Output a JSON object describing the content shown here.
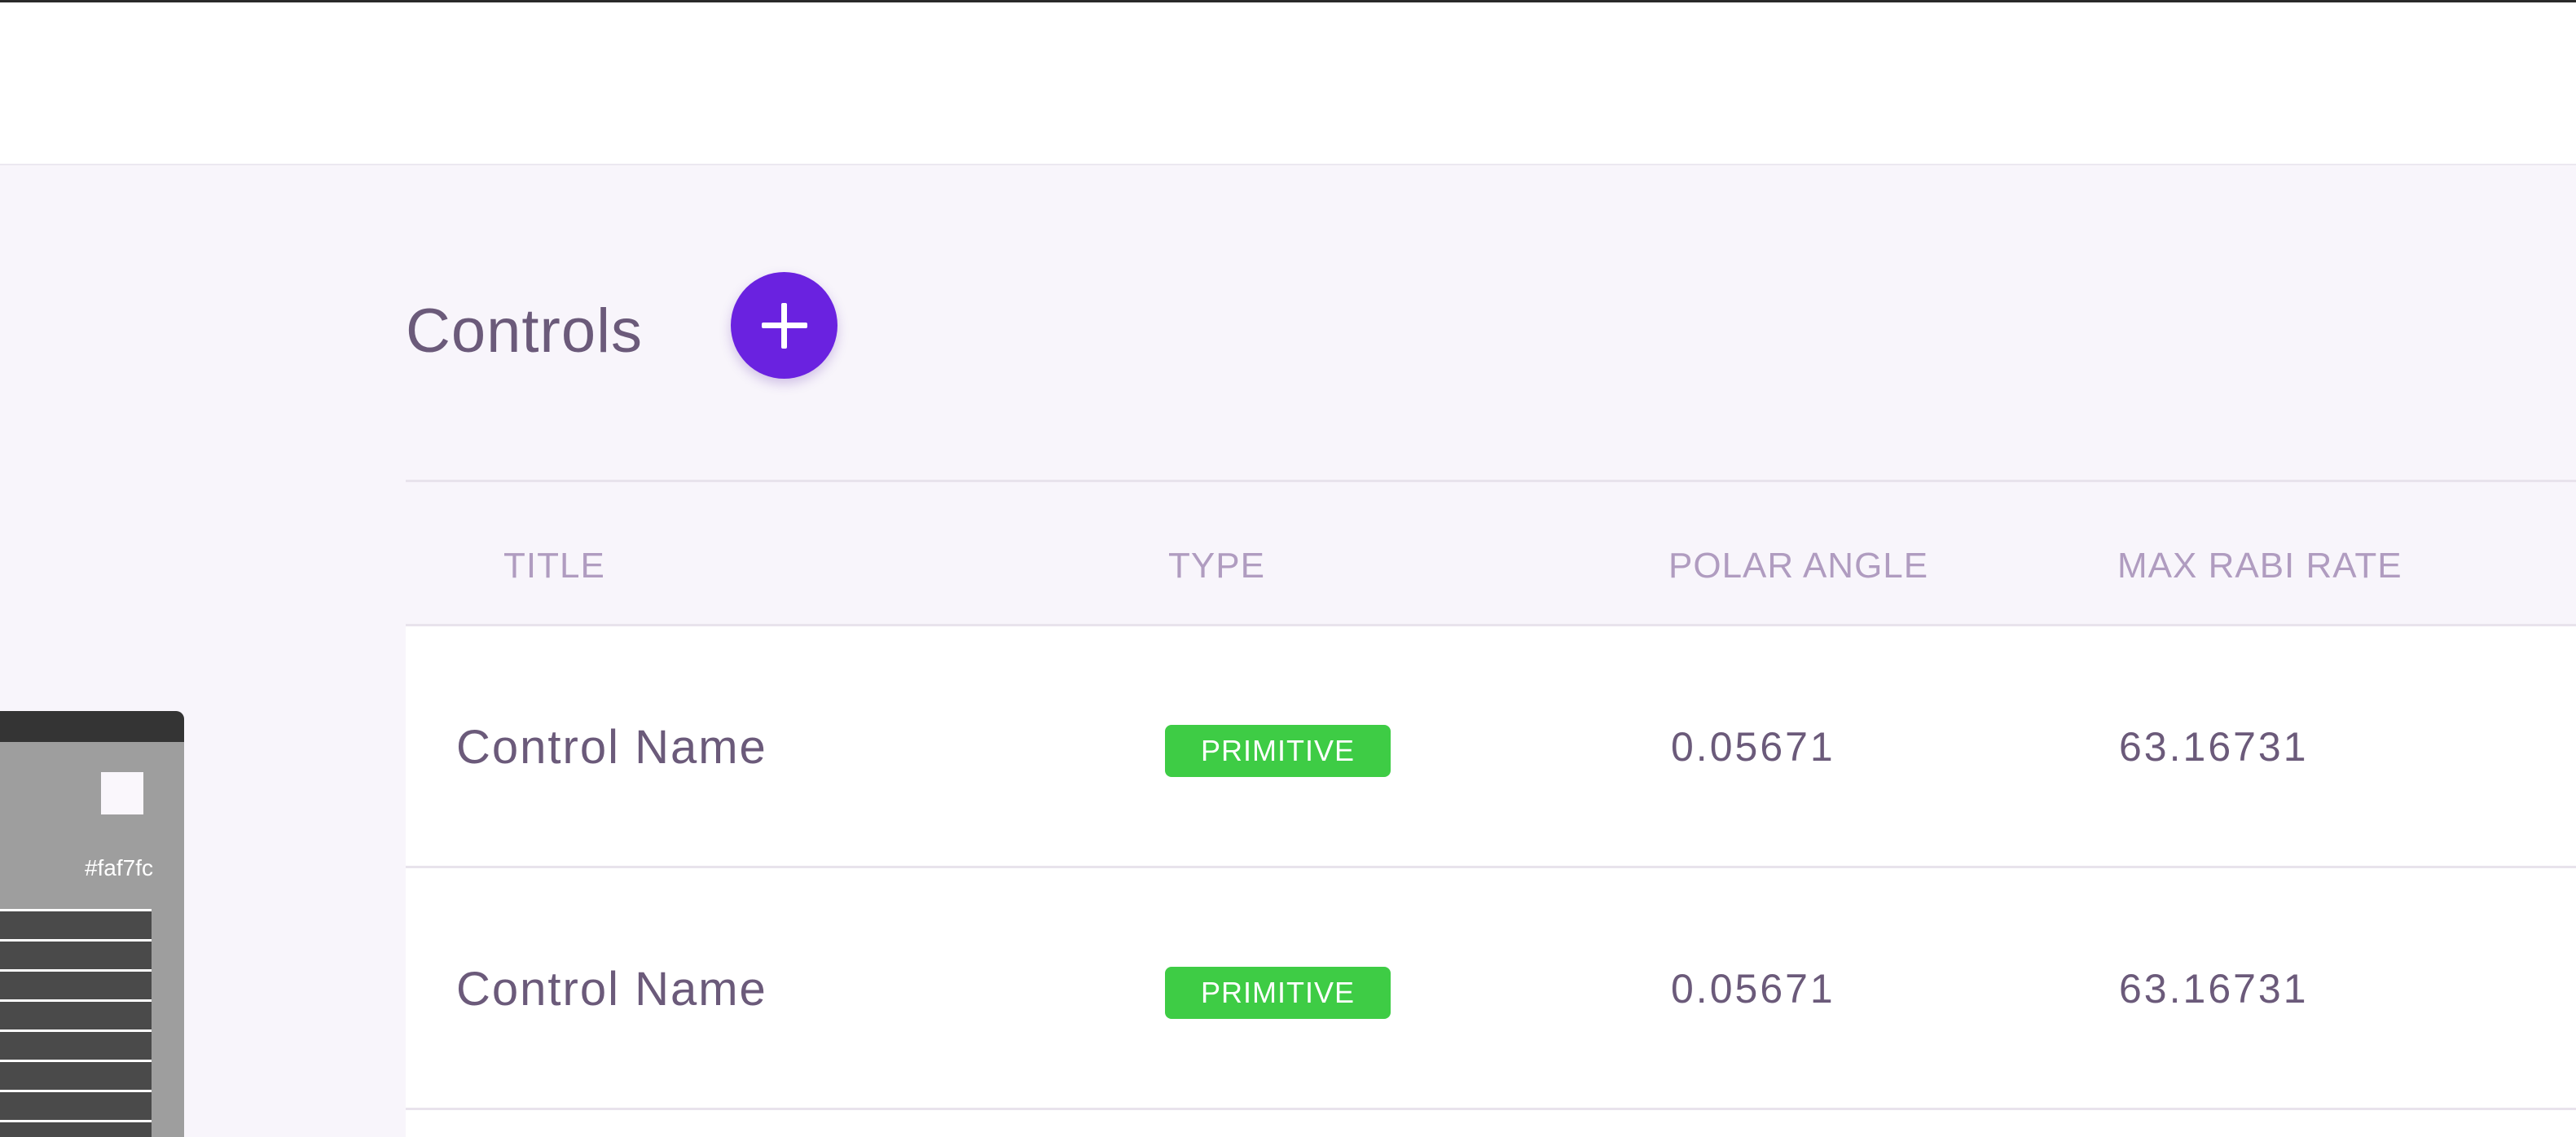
{
  "page": {
    "title": "Controls",
    "add_icon": "plus-icon",
    "accent_color": "#6a22e0"
  },
  "table": {
    "columns": [
      "TITLE",
      "TYPE",
      "POLAR ANGLE",
      "MAX RABI RATE"
    ],
    "rows": [
      {
        "title": "Control Name",
        "type": "PRIMITIVE",
        "polar_angle": "0.05671",
        "max_rabi_rate": "63.16731"
      },
      {
        "title": "Control Name",
        "type": "PRIMITIVE",
        "polar_angle": "0.05671",
        "max_rabi_rate": "63.16731"
      }
    ],
    "badge_color": "#3ecc45"
  },
  "color_picker": {
    "hex_value": "#faf7fc"
  }
}
